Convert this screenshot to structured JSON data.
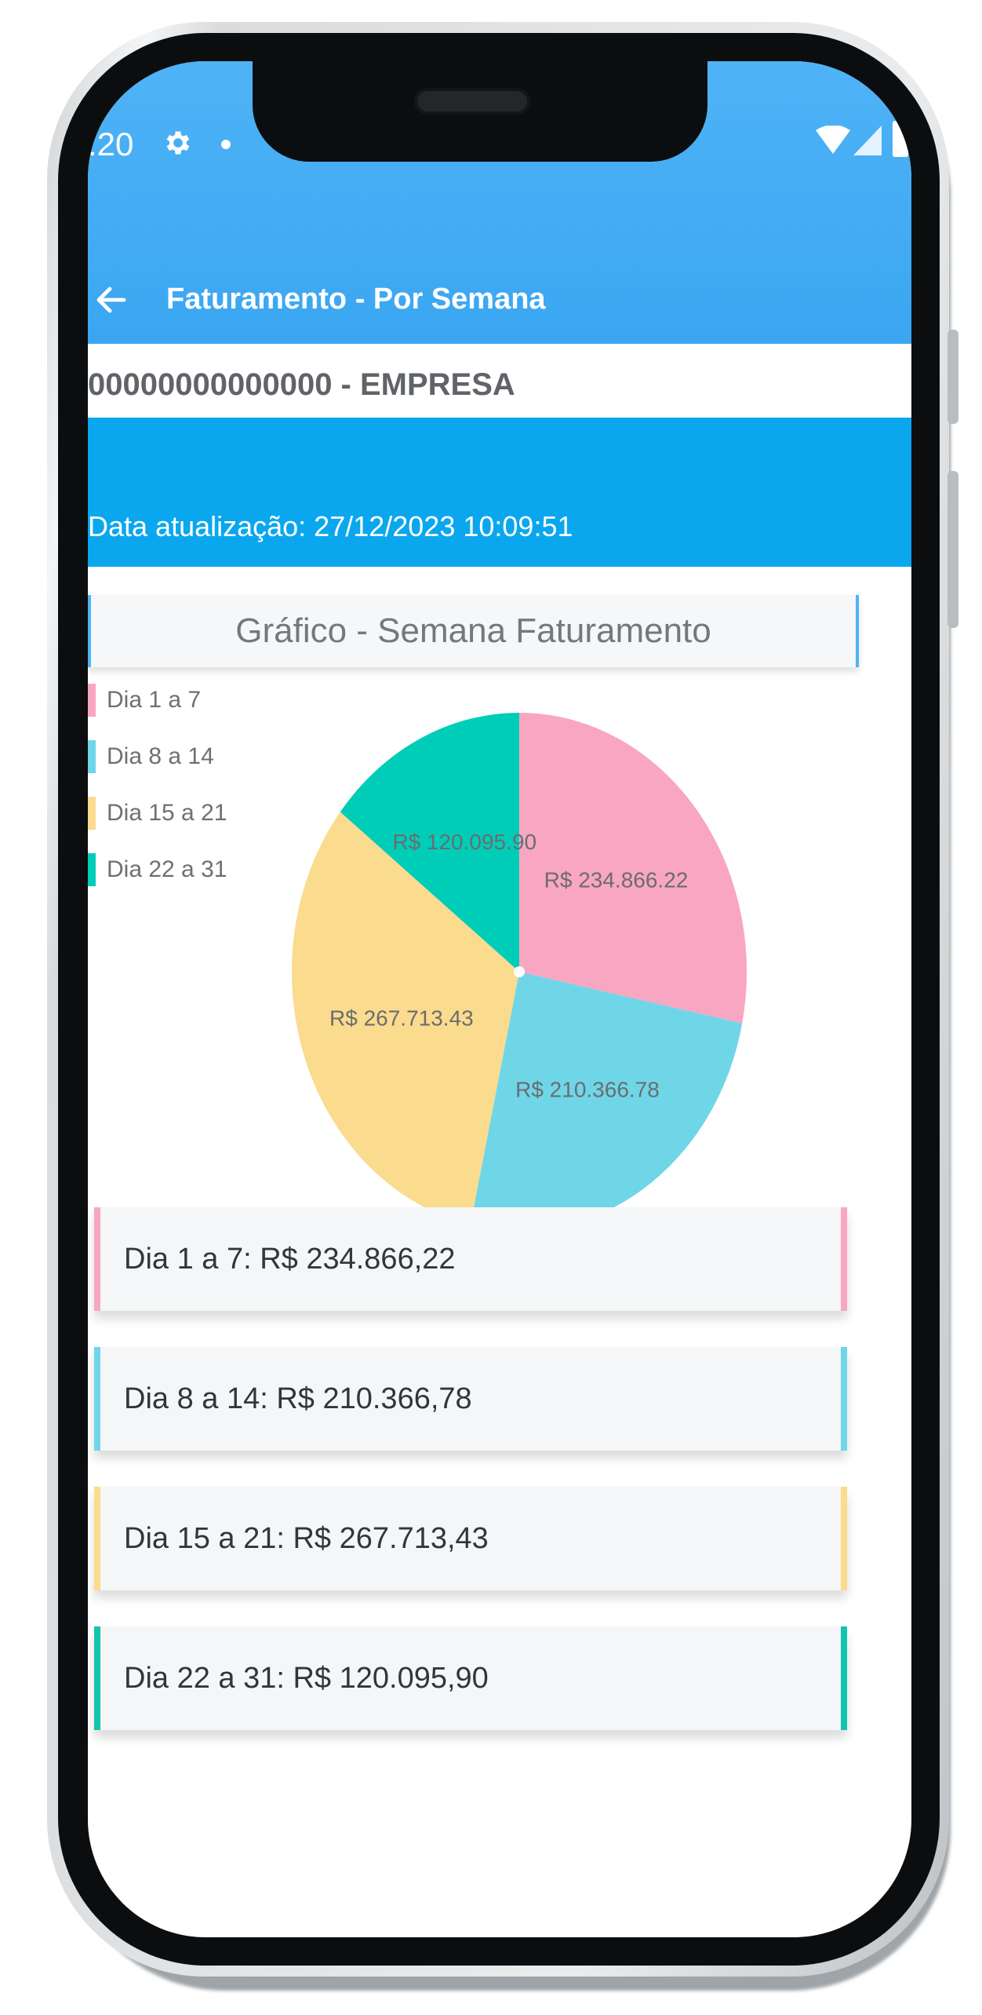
{
  "status_bar": {
    "time": ":20",
    "icons": [
      "gear-icon",
      "notification-dot",
      "wifi-icon",
      "signal-icon",
      "battery-icon"
    ]
  },
  "app_bar": {
    "title": "Faturamento - Por Semana",
    "back_icon": "arrow-left-icon"
  },
  "company": "00000000000000 - EMPRESA",
  "update_info": "Data atualização: 27/12/2023 10:09:51",
  "chart_section": {
    "title": "Gráfico - Semana Faturamento"
  },
  "chart_data": {
    "type": "pie",
    "categories": [
      "Dia 1 a 7",
      "Dia 8 a 14",
      "Dia 15 a 21",
      "Dia 22 a 31"
    ],
    "values": [
      234866.22,
      210366.78,
      267713.43,
      120095.9
    ],
    "labels": [
      "R$ 234.866.22",
      "R$ 210.366.78",
      "R$ 267.713.43",
      "R$ 120.095.90"
    ],
    "colors": [
      "#f9a6c2",
      "#6fd6e8",
      "#fbdb8e",
      "#00cdb8"
    ],
    "legend_placement": "left"
  },
  "legend": [
    {
      "label": "Dia 1 a 7",
      "color": "#f9a6c2"
    },
    {
      "label": "Dia 8 a 14",
      "color": "#6fd6e8"
    },
    {
      "label": "Dia 15 a 21",
      "color": "#fbdb8e"
    },
    {
      "label": "Dia 22 a 31",
      "color": "#00cdb8"
    }
  ],
  "summary_cards": [
    {
      "text": "Dia 1 a 7:  R$ 234.866,22",
      "color": "#f9a6c2"
    },
    {
      "text": "Dia 8 a 14:  R$ 210.366,78",
      "color": "#6fd6e8"
    },
    {
      "text": "Dia 15 a 21:  R$ 267.713,43",
      "color": "#fbdb8e"
    },
    {
      "text": "Dia 22 a 31:  R$ 120.095,90",
      "color": "#12c4ad"
    }
  ]
}
